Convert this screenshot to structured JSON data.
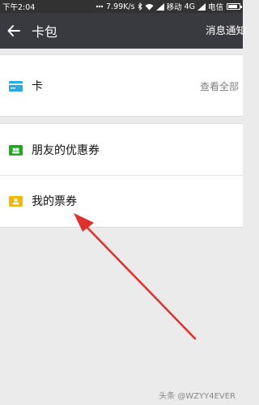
{
  "status_bar": {
    "time": "下午2:04",
    "speed": "7.99K/s",
    "carrier1": "移动",
    "network1": "4G",
    "carrier2": "电信",
    "battery_level": 0.85
  },
  "header": {
    "title": "卡包",
    "action_label": "消息通知"
  },
  "cards_section": {
    "label": "卡",
    "view_all": "查看全部"
  },
  "coupons": [
    {
      "label": "朋友的优惠券",
      "icon": "ticket-green-icon",
      "color": "#1aad19"
    },
    {
      "label": "我的票券",
      "icon": "ticket-yellow-icon",
      "color": "#f5b800"
    }
  ],
  "colors": {
    "card_icon": "#2aaae4",
    "annotation_arrow": "#e0302c",
    "app_bar": "#393a3f"
  },
  "watermark": "头条 @WZYY4EVER"
}
